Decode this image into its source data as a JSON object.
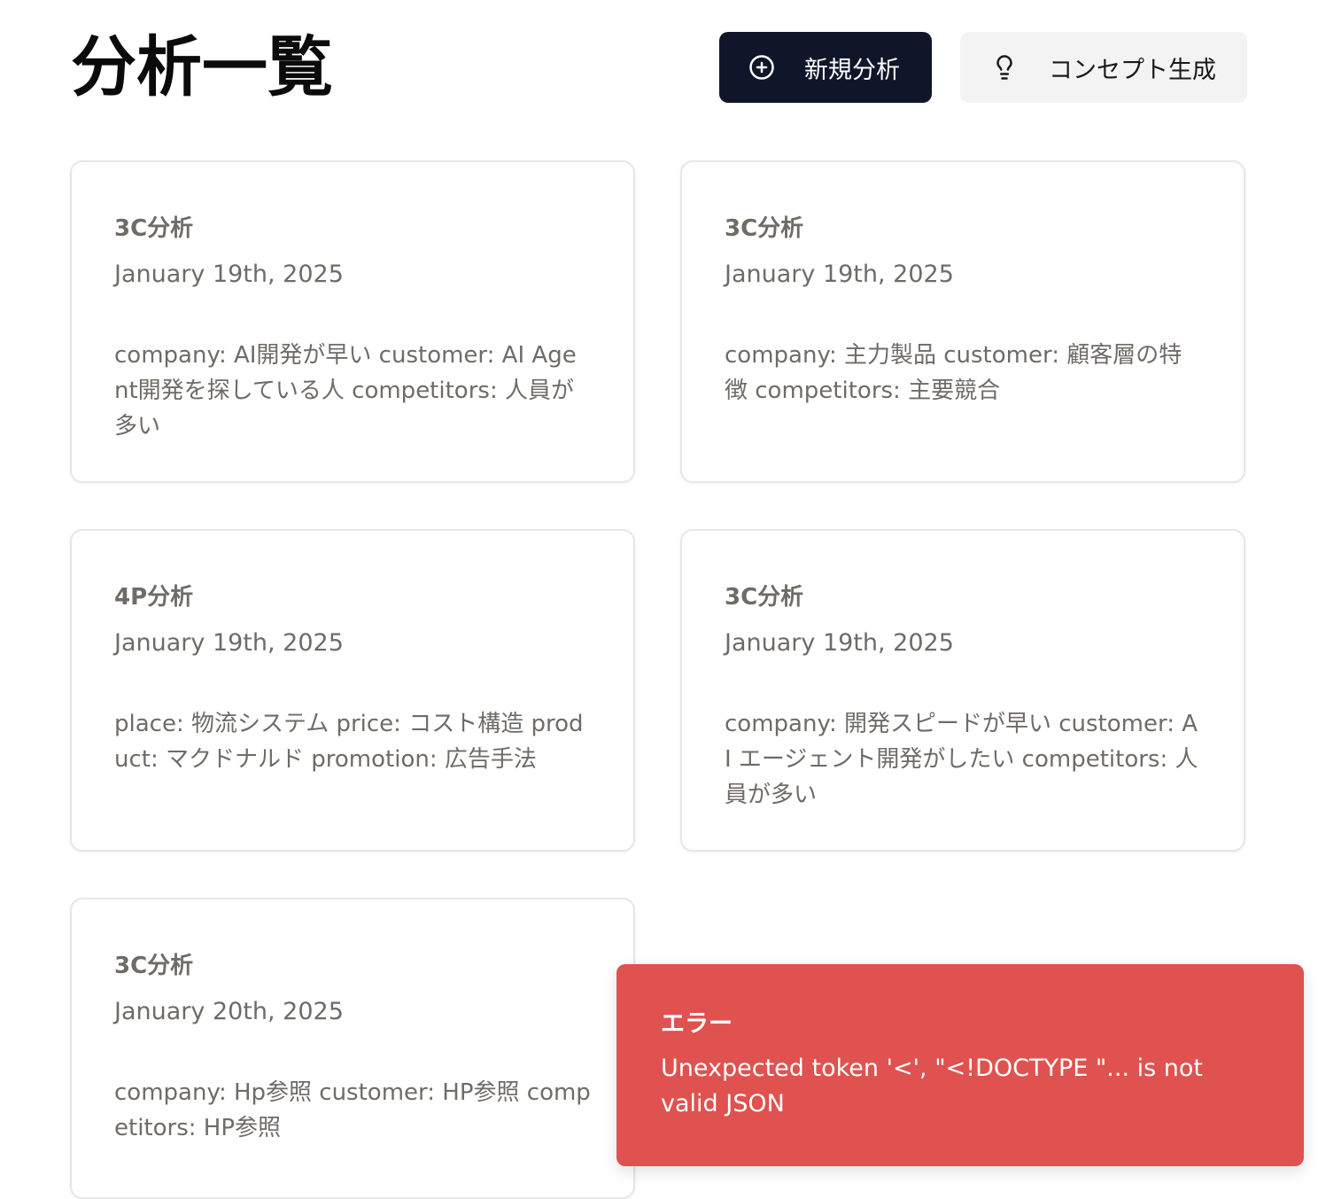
{
  "header": {
    "title": "分析一覧",
    "new_analysis_label": "新規分析",
    "new_analysis_icon": "plus-circle-icon",
    "concept_label": "コンセプト生成",
    "concept_icon": "lightbulb-icon"
  },
  "cards": [
    {
      "title": "3C分析",
      "date": "January 19th, 2025",
      "description": "company: AI開発が早い customer: AI Agent開発を探している人 competitors: 人員が多い"
    },
    {
      "title": "3C分析",
      "date": "January 19th, 2025",
      "description": "company: 主力製品 customer: 顧客層の特徴 competitors: 主要競合"
    },
    {
      "title": "4P分析",
      "date": "January 19th, 2025",
      "description": "place: 物流システム price: コスト構造 product: マクドナルド promotion: 広告手法"
    },
    {
      "title": "3C分析",
      "date": "January 19th, 2025",
      "description": "company: 開発スピードが早い customer: AI エージェント開発がしたい competitors: 人員が多い"
    },
    {
      "title": "3C分析",
      "date": "January 20th, 2025",
      "description": "company: Hp参照 customer: HP参照 competitors: HP参照"
    }
  ],
  "toast": {
    "title": "エラー",
    "message": "Unexpected token '<', \"<!DOCTYPE \"... is not valid JSON"
  },
  "colors": {
    "primary": "#0f1629",
    "secondary_bg": "#f3f3f3",
    "card_text": "#6f6b66",
    "toast_bg": "#df524f"
  }
}
